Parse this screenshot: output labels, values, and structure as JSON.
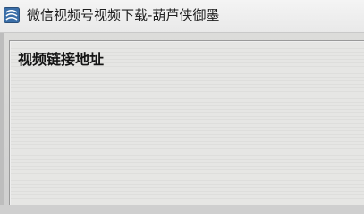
{
  "window": {
    "title": "微信视频号视频下载-葫芦侠御墨",
    "icon": "app-logo-icon"
  },
  "main": {
    "section_label": "视频链接地址"
  }
}
